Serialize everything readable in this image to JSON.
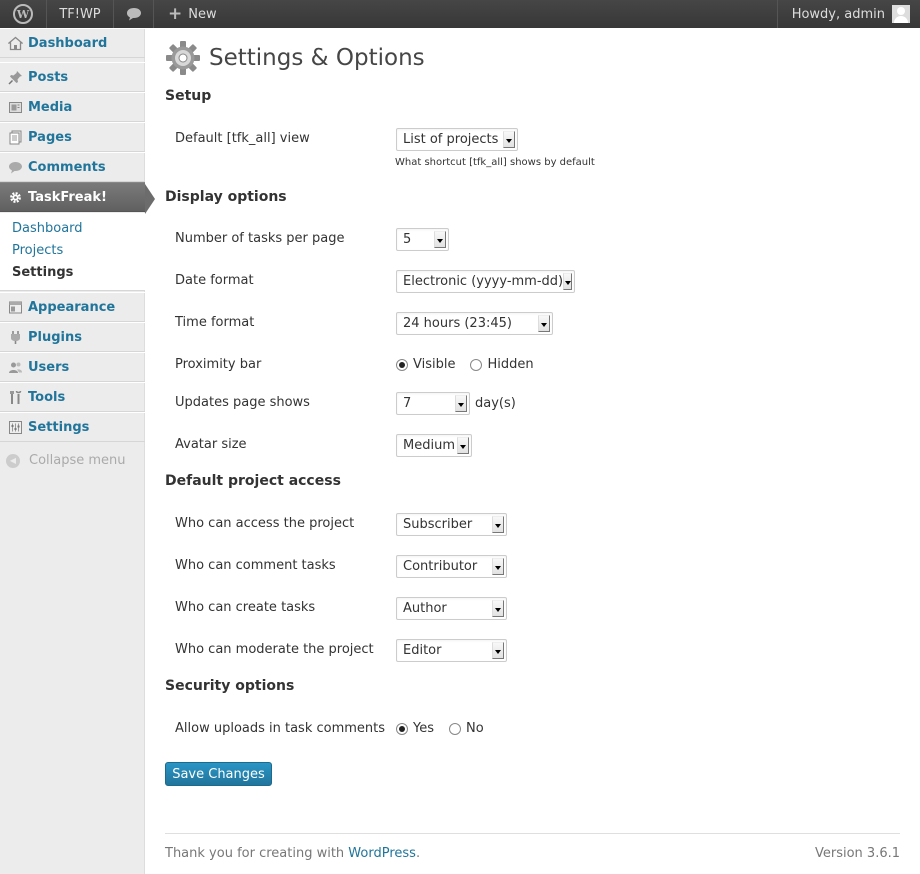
{
  "adminbar": {
    "site_name": "TF!WP",
    "new_label": "New",
    "howdy": "Howdy, admin"
  },
  "sidebar": {
    "items": [
      {
        "label": "Dashboard",
        "icon": "dashboard-icon"
      },
      {
        "label": "Posts",
        "icon": "pin-icon"
      },
      {
        "label": "Media",
        "icon": "media-icon"
      },
      {
        "label": "Pages",
        "icon": "pages-icon"
      },
      {
        "label": "Comments",
        "icon": "comment-bubble-icon"
      },
      {
        "label": "TaskFreak!",
        "icon": "gear-icon"
      },
      {
        "label": "Appearance",
        "icon": "appearance-icon"
      },
      {
        "label": "Plugins",
        "icon": "plug-icon"
      },
      {
        "label": "Users",
        "icon": "users-icon"
      },
      {
        "label": "Tools",
        "icon": "tools-icon"
      },
      {
        "label": "Settings",
        "icon": "settings-icon"
      }
    ],
    "submenu": [
      {
        "label": "Dashboard"
      },
      {
        "label": "Projects"
      },
      {
        "label": "Settings"
      }
    ],
    "collapse_label": "Collapse menu"
  },
  "page": {
    "title": "Settings & Options"
  },
  "setup": {
    "heading": "Setup",
    "default_view_label": "Default [tfk_all] view",
    "default_view_value": "List of projects",
    "default_view_hint": "What shortcut [tfk_all] shows by default"
  },
  "display": {
    "heading": "Display options",
    "tasks_per_page_label": "Number of tasks per page",
    "tasks_per_page_value": "5",
    "date_format_label": "Date format",
    "date_format_value": "Electronic (yyyy-mm-dd)",
    "time_format_label": "Time format",
    "time_format_value": "24 hours (23:45)",
    "proximity_label": "Proximity bar",
    "proximity_options": [
      "Visible",
      "Hidden"
    ],
    "proximity_selected": "Visible",
    "updates_label": "Updates page shows",
    "updates_value": "7",
    "updates_unit": "day(s)",
    "avatar_label": "Avatar size",
    "avatar_value": "Medium"
  },
  "access": {
    "heading": "Default project access",
    "access_label": "Who can access the project",
    "access_value": "Subscriber",
    "comment_label": "Who can comment tasks",
    "comment_value": "Contributor",
    "create_label": "Who can create tasks",
    "create_value": "Author",
    "moderate_label": "Who can moderate the project",
    "moderate_value": "Editor"
  },
  "security": {
    "heading": "Security options",
    "uploads_label": "Allow uploads in task comments",
    "uploads_options": [
      "Yes",
      "No"
    ],
    "uploads_selected": "Yes"
  },
  "actions": {
    "save_label": "Save Changes"
  },
  "footer": {
    "thanks_prefix": "Thank you for creating with ",
    "thanks_link": "WordPress",
    "thanks_suffix": ".",
    "version": "Version 3.6.1"
  },
  "colors": {
    "link": "#21759b",
    "adminbar_bg": "#464646",
    "current_menu_bg": "#6c6c6c",
    "button_primary": "#21759b"
  }
}
